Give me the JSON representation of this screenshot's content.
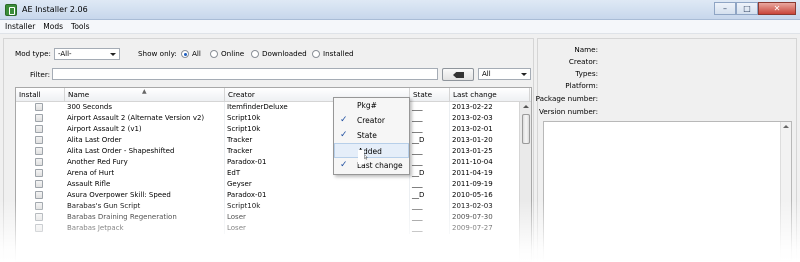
{
  "window": {
    "title": "AE Installer 2.06",
    "buttons": {
      "minimize": "–",
      "maximize": "□",
      "close": "✕"
    }
  },
  "menu": [
    "Installer",
    "Mods",
    "Tools"
  ],
  "filters": {
    "mod_type_label": "Mod type:",
    "mod_type_value": "-All-",
    "show_only_label": "Show only:",
    "show_options": [
      "All",
      "Online",
      "Downloaded",
      "Installed"
    ],
    "show_selected": "All",
    "filter_label": "Filter:",
    "filter_value": "",
    "filter_scope_value": "All"
  },
  "table": {
    "columns": [
      "Install",
      "Name",
      "Creator",
      "State",
      "Last change"
    ],
    "rows": [
      {
        "name": "300 Seconds",
        "creator": "ItemfinderDeluxe",
        "state": "___",
        "last_change": "2013-02-22"
      },
      {
        "name": "Airport Assault 2 (Alternate Version v2)",
        "creator": "Script10k",
        "state": "___",
        "last_change": "2013-02-03"
      },
      {
        "name": "Airport Assault 2 (v1)",
        "creator": "Script10k",
        "state": "___",
        "last_change": "2013-02-01"
      },
      {
        "name": "Alita Last Order",
        "creator": "Tracker",
        "state": "__D",
        "last_change": "2013-01-20"
      },
      {
        "name": "Alita Last Order - Shapeshifted",
        "creator": "Tracker",
        "state": "___",
        "last_change": "2013-01-25"
      },
      {
        "name": "Another Red Fury",
        "creator": "Paradox-01",
        "state": "___",
        "last_change": "2011-10-04"
      },
      {
        "name": "Arena of Hurt",
        "creator": "EdT",
        "state": "__D",
        "last_change": "2011-04-19"
      },
      {
        "name": "Assault Rifle",
        "creator": "Geyser",
        "state": "___",
        "last_change": "2011-09-19"
      },
      {
        "name": "Asura Overpower Skill: Speed",
        "creator": "Paradox-01",
        "state": "__D",
        "last_change": "2010-05-16"
      },
      {
        "name": "Barabas's Gun Script",
        "creator": "Script10k",
        "state": "___",
        "last_change": "2013-02-03"
      },
      {
        "name": "Barabas Draining Regeneration",
        "creator": "Loser",
        "state": "___",
        "last_change": "2009-07-30"
      },
      {
        "name": "Barabas Jetpack",
        "creator": "Loser",
        "state": "___",
        "last_change": "2009-07-27"
      }
    ]
  },
  "column_menu": {
    "items": [
      {
        "label": "Pkg#",
        "checked": false
      },
      {
        "label": "Creator",
        "checked": true
      },
      {
        "label": "State",
        "checked": true
      },
      {
        "label": "Added",
        "checked": false
      },
      {
        "label": "Last change",
        "checked": true
      }
    ],
    "check_glyph": "✓"
  },
  "details": {
    "labels": [
      "Name:",
      "Creator:",
      "Types:",
      "Platform:",
      "Package number:",
      "Version number:"
    ]
  }
}
